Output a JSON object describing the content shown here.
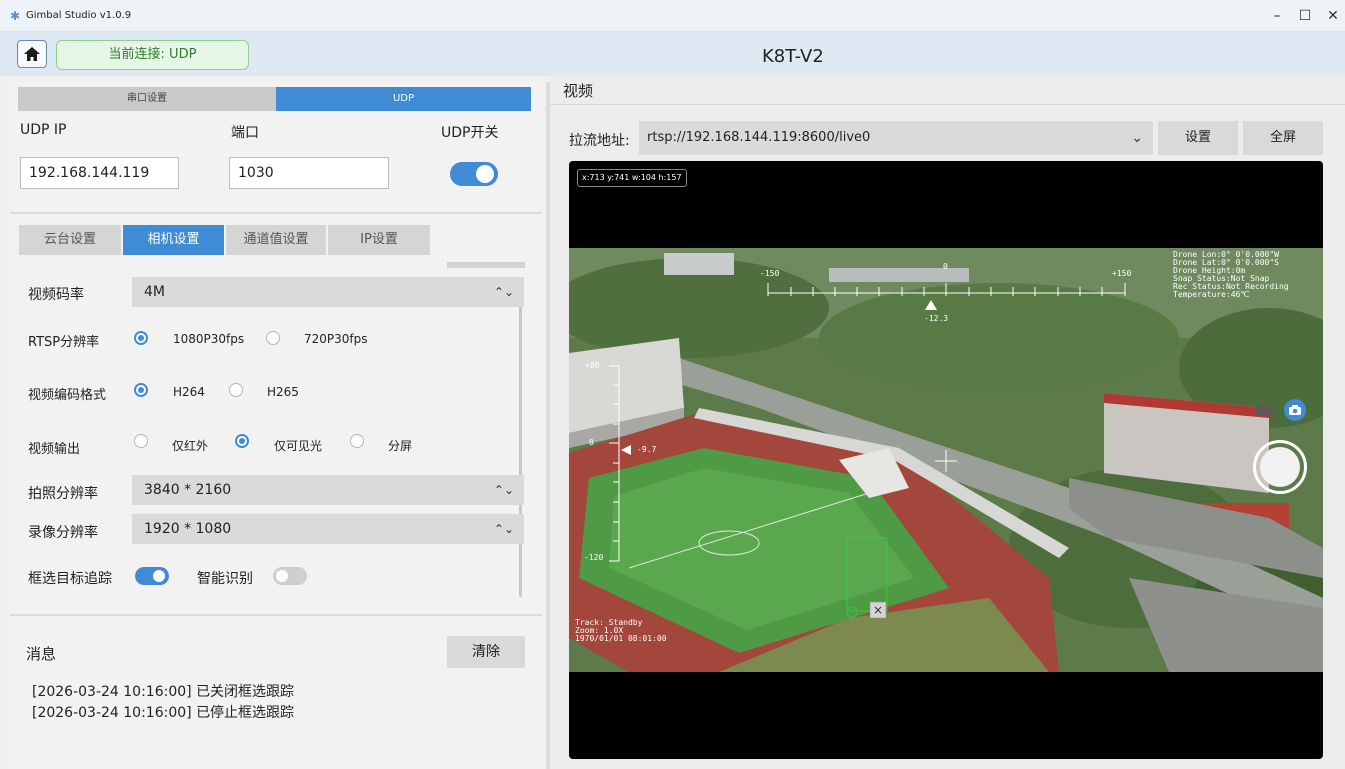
{
  "window": {
    "title": "Gimbal Studio v1.0.9"
  },
  "header": {
    "connection": "当前连接: UDP",
    "device": "K8T-V2"
  },
  "left": {
    "conn_tabs": [
      "串口设置",
      "UDP"
    ],
    "udp_ip_label": "UDP IP",
    "port_label": "端口",
    "switch_label": "UDP开关",
    "udp_ip": "192.168.144.119",
    "port": "1030",
    "sub_tabs": [
      "云台设置",
      "相机设置",
      "通道值设置",
      "IP设置"
    ],
    "camera": {
      "bitrate_label": "视频码率",
      "bitrate": "4M",
      "rtsp_label": "RTSP分辨率",
      "rtsp_opt1": "1080P30fps",
      "rtsp_opt2": "720P30fps",
      "codec_label": "视频编码格式",
      "codec_opt1": "H264",
      "codec_opt2": "H265",
      "output_label": "视频输出",
      "output_opt1": "仅红外",
      "output_opt2": "仅可见光",
      "output_opt3": "分屏",
      "photo_res_label": "拍照分辨率",
      "photo_res": "3840 * 2160",
      "rec_res_label": "录像分辨率",
      "rec_res": "1920 * 1080",
      "track_label": "框选目标追踪",
      "ai_label": "智能识别"
    },
    "messages": {
      "title": "消息",
      "clear": "清除",
      "lines": [
        "[2026-03-24 10:16:00] 已关闭框选跟踪",
        "[2026-03-24 10:16:00] 已停止框选跟踪"
      ]
    }
  },
  "right": {
    "section": "视频",
    "stream_label": "拉流地址:",
    "stream_url": "rtsp://192.168.144.119:8600/live0",
    "settings_btn": "设置",
    "fullscreen_btn": "全屏",
    "box_info": "x:713 y:741 w:104 h:157",
    "osd": {
      "yaw_left": "-150",
      "yaw_center": "0",
      "yaw_right": "+150",
      "yaw_value": "-12.3",
      "pitch_top": "+80",
      "pitch_zero": "0",
      "pitch_bottom": "-120",
      "pitch_value": "-9.7",
      "info_lines": [
        "Drone Lon:0° 0'0.000\"W",
        "Drone Lat:0° 0'0.000\"S",
        "Drone Height:0m",
        "Snap Status:Not Snap",
        "Rec Status:Not Recording",
        "Temperature:46℃"
      ],
      "track_lines": [
        "Track: Standby",
        "Zoom: 1.0X",
        "1970/01/01 08:01:00"
      ]
    }
  }
}
